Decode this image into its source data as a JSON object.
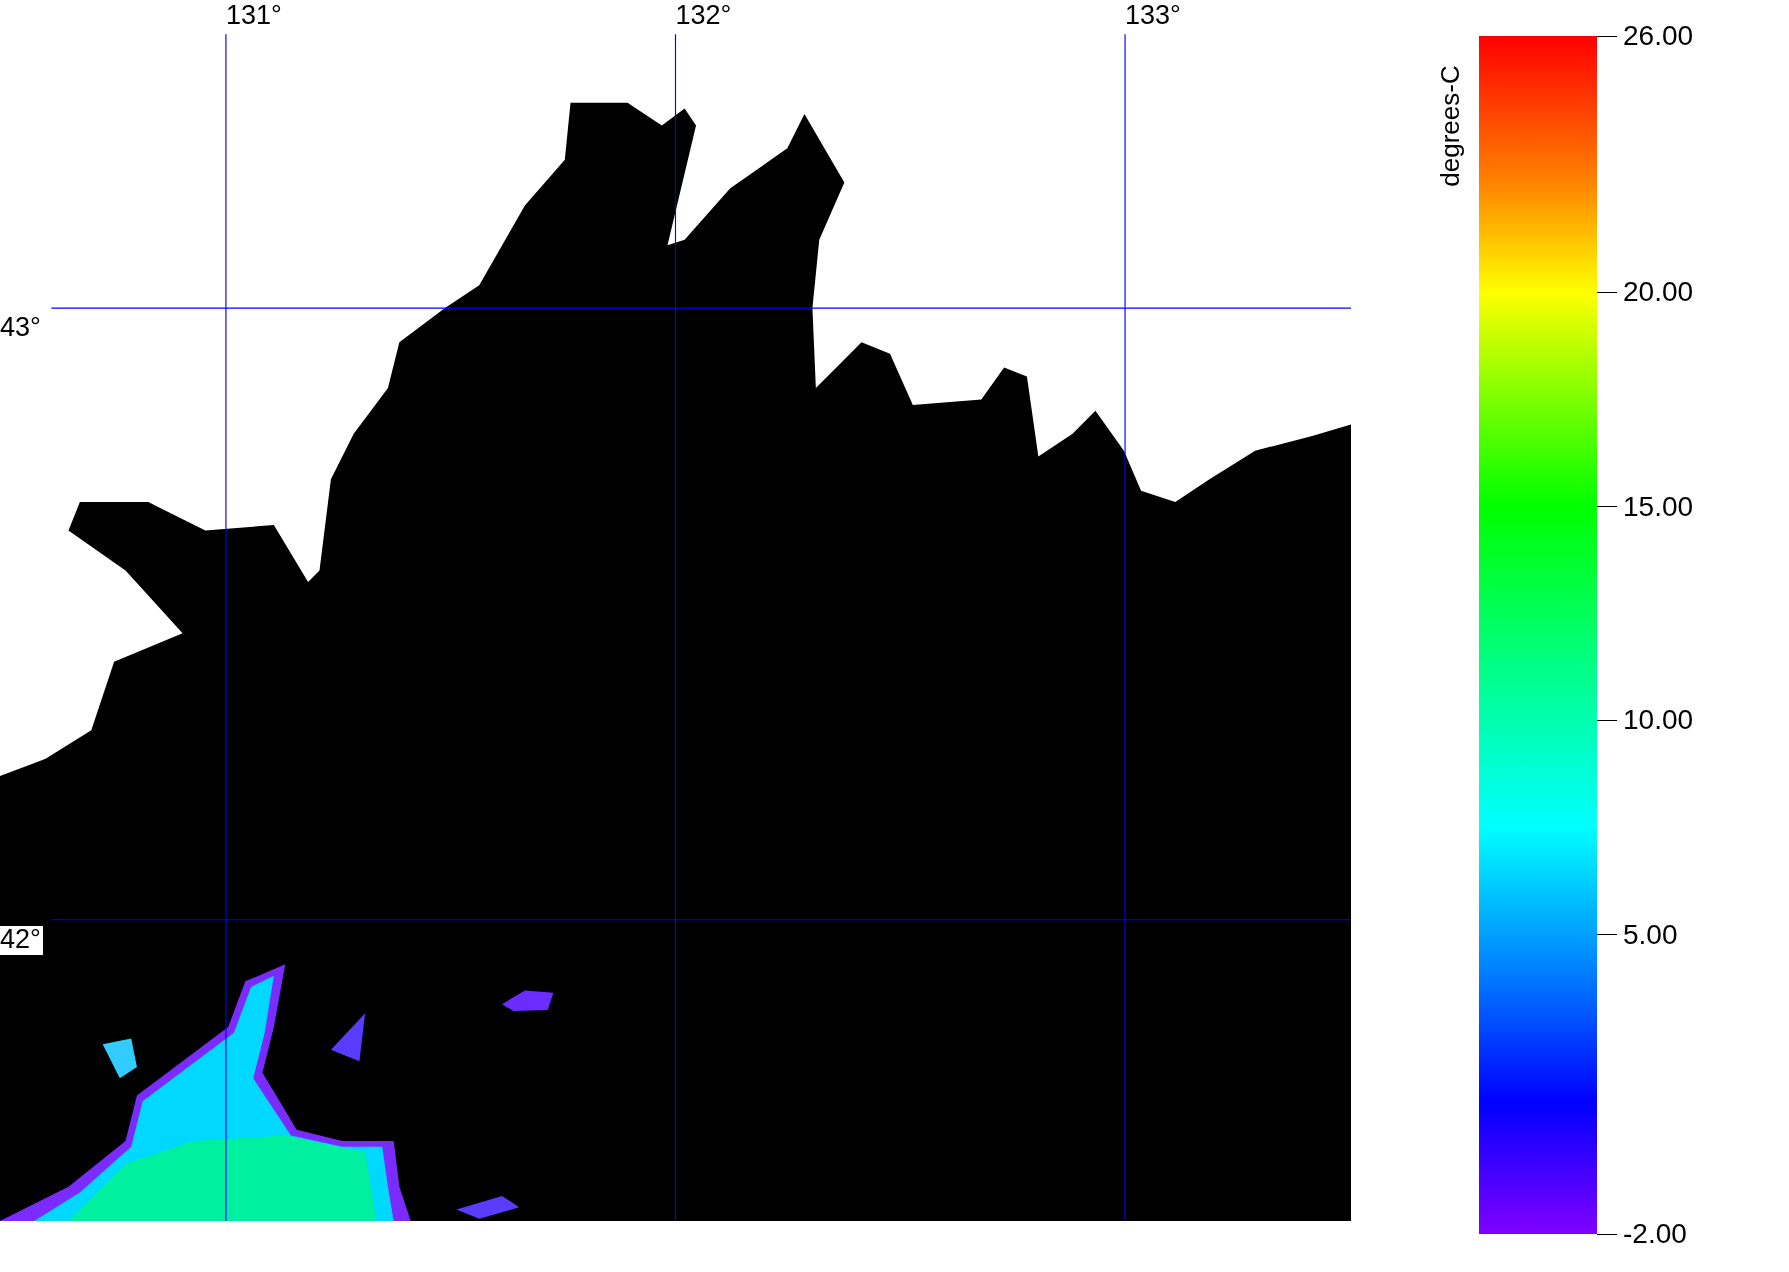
{
  "map": {
    "longitude_labels": [
      "131°",
      "132°",
      "133°"
    ],
    "latitude_labels": [
      "43°",
      "42°"
    ]
  },
  "colorbar": {
    "unit": "degrees-C",
    "ticks": [
      "26.00",
      "20.00",
      "15.00",
      "10.00",
      "5.00",
      "-2.00"
    ]
  }
}
